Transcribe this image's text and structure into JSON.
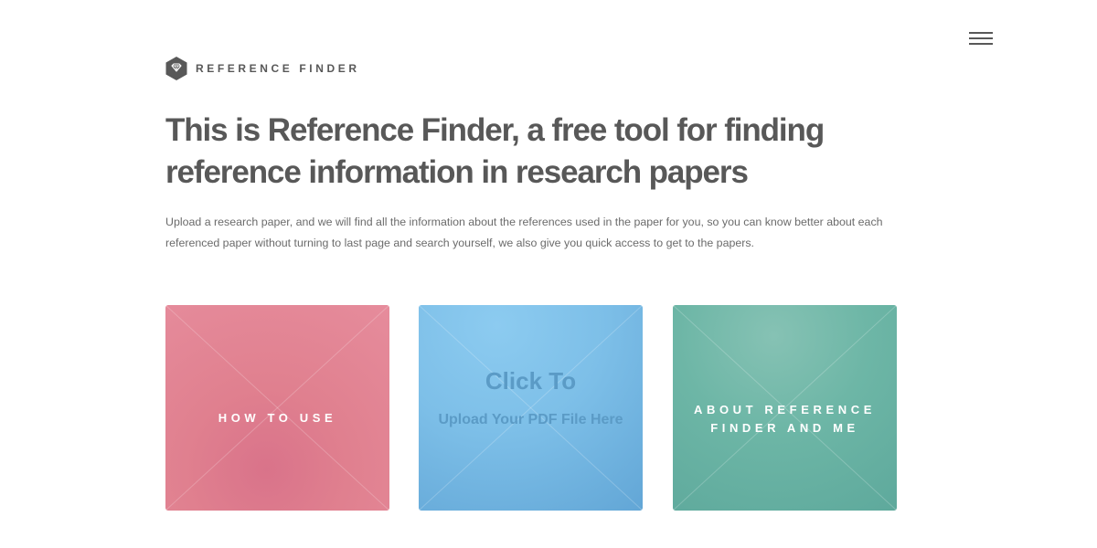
{
  "header": {
    "brand_name": "REFERENCE FINDER",
    "logo_icon": "gem-hexagon-icon",
    "menu_icon": "hamburger-menu-icon"
  },
  "main": {
    "headline": "This is Reference Finder, a free tool for finding reference information in research papers",
    "intro": "Upload a research paper, and we will find all the information about the references used in the paper for you, so you can know better about each referenced paper without turning to last page and search yourself, we also give you quick access to get to the papers."
  },
  "tiles": {
    "how_to_use": {
      "label": "HOW TO USE",
      "color": "#e2818f"
    },
    "upload": {
      "title": "Click To",
      "subtitle": "Upload Your PDF File Here",
      "color": "#7cbde8"
    },
    "about": {
      "line1": "ABOUT REFERENCE",
      "line2": "FINDER AND ME",
      "color": "#6ab3a3"
    }
  }
}
